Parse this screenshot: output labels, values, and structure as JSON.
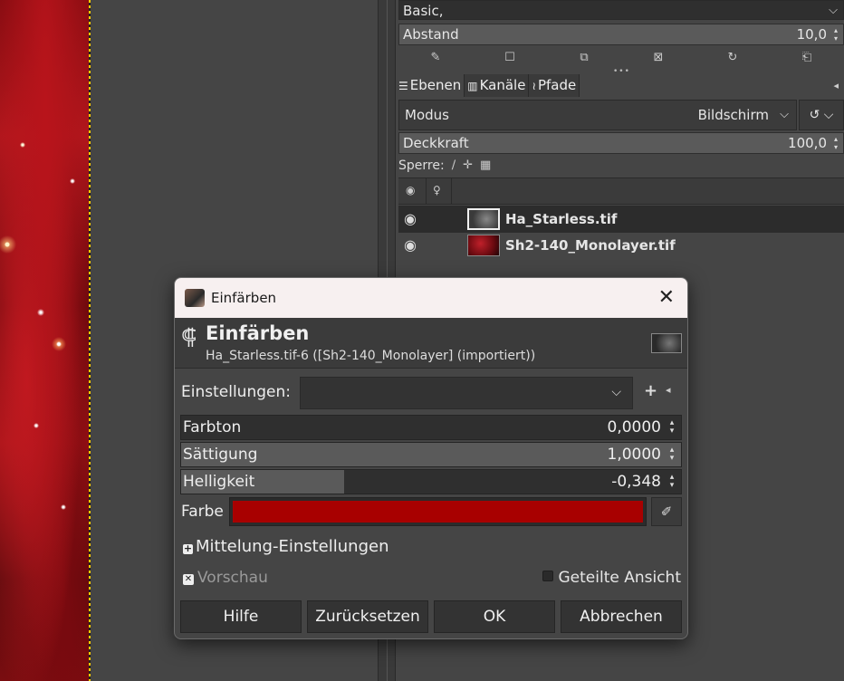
{
  "dock": {
    "brush_preset": "Basic,",
    "abstand_label": "Abstand",
    "abstand_value": "10,0",
    "tabs": [
      {
        "icon": "layers-icon",
        "label": "Ebenen"
      },
      {
        "icon": "channels-icon",
        "label": "Kanäle"
      },
      {
        "icon": "paths-icon",
        "label": "Pfade"
      }
    ],
    "modus_label": "Modus",
    "modus_value": "Bildschirm",
    "deckkraft_label": "Deckkraft",
    "deckkraft_value": "100,0",
    "sperre_label": "Sperre:",
    "layers": [
      {
        "name": "Ha_Starless.tif",
        "visible": true,
        "selected": true
      },
      {
        "name": "Sh2-140_Monolayer.tif",
        "visible": true,
        "selected": false
      }
    ]
  },
  "dialog": {
    "window_title": "Einfärben",
    "header_title": "Einfärben",
    "header_subtitle": "Ha_Starless.tif-6 ([Sh2-140_Monolayer] (importiert))",
    "settings_label": "Einstellungen:",
    "settings_value": "",
    "sliders": {
      "farbton": {
        "label": "Farbton",
        "value": "0,0000",
        "level": 0.0
      },
      "saettigung": {
        "label": "Sättigung",
        "value": "1,0000",
        "level": 1.0
      },
      "helligkeit": {
        "label": "Helligkeit",
        "value": "-0,348",
        "level": 0.326
      }
    },
    "farbe_label": "Farbe",
    "farbe_color": "#a80000",
    "mittelung_label": "Mittelung-Einstellungen",
    "vorschau_label": "Vorschau",
    "vorschau_checked": true,
    "geteilt_label": "Geteilte Ansicht",
    "geteilt_checked": false,
    "buttons": {
      "help": "Hilfe",
      "reset": "Zurücksetzen",
      "ok": "OK",
      "cancel": "Abbrechen"
    }
  }
}
